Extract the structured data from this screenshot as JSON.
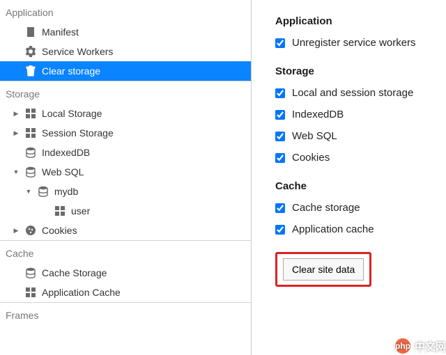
{
  "left": {
    "groups": [
      {
        "title": "Application",
        "items": [
          {
            "icon": "manifest",
            "label": "Manifest",
            "indent": 1
          },
          {
            "icon": "gear",
            "label": "Service Workers",
            "indent": 1
          },
          {
            "icon": "trash",
            "label": "Clear storage",
            "indent": 1,
            "selected": true
          }
        ]
      },
      {
        "title": "Storage",
        "items": [
          {
            "icon": "grid",
            "label": "Local Storage",
            "indent": 1,
            "expandable": true,
            "expanded": false
          },
          {
            "icon": "grid",
            "label": "Session Storage",
            "indent": 1,
            "expandable": true,
            "expanded": false
          },
          {
            "icon": "db",
            "label": "IndexedDB",
            "indent": 1
          },
          {
            "icon": "db",
            "label": "Web SQL",
            "indent": 1,
            "expandable": true,
            "expanded": true
          },
          {
            "icon": "db",
            "label": "mydb",
            "indent": 2,
            "expandable": true,
            "expanded": true
          },
          {
            "icon": "grid",
            "label": "user",
            "indent": 3
          },
          {
            "icon": "cookie",
            "label": "Cookies",
            "indent": 1,
            "expandable": true,
            "expanded": false
          }
        ]
      },
      {
        "title": "Cache",
        "items": [
          {
            "icon": "db",
            "label": "Cache Storage",
            "indent": 1
          },
          {
            "icon": "grid",
            "label": "Application Cache",
            "indent": 1
          }
        ]
      },
      {
        "title": "Frames",
        "items": []
      }
    ]
  },
  "right": {
    "sections": [
      {
        "title": "Application",
        "checks": [
          {
            "label": "Unregister service workers",
            "checked": true
          }
        ]
      },
      {
        "title": "Storage",
        "checks": [
          {
            "label": "Local and session storage",
            "checked": true
          },
          {
            "label": "IndexedDB",
            "checked": true
          },
          {
            "label": "Web SQL",
            "checked": true
          },
          {
            "label": "Cookies",
            "checked": true
          }
        ]
      },
      {
        "title": "Cache",
        "checks": [
          {
            "label": "Cache storage",
            "checked": true
          },
          {
            "label": "Application cache",
            "checked": true
          }
        ]
      }
    ],
    "clear_button": "Clear site data"
  },
  "watermark": {
    "badge": "php",
    "text": "中文网"
  }
}
